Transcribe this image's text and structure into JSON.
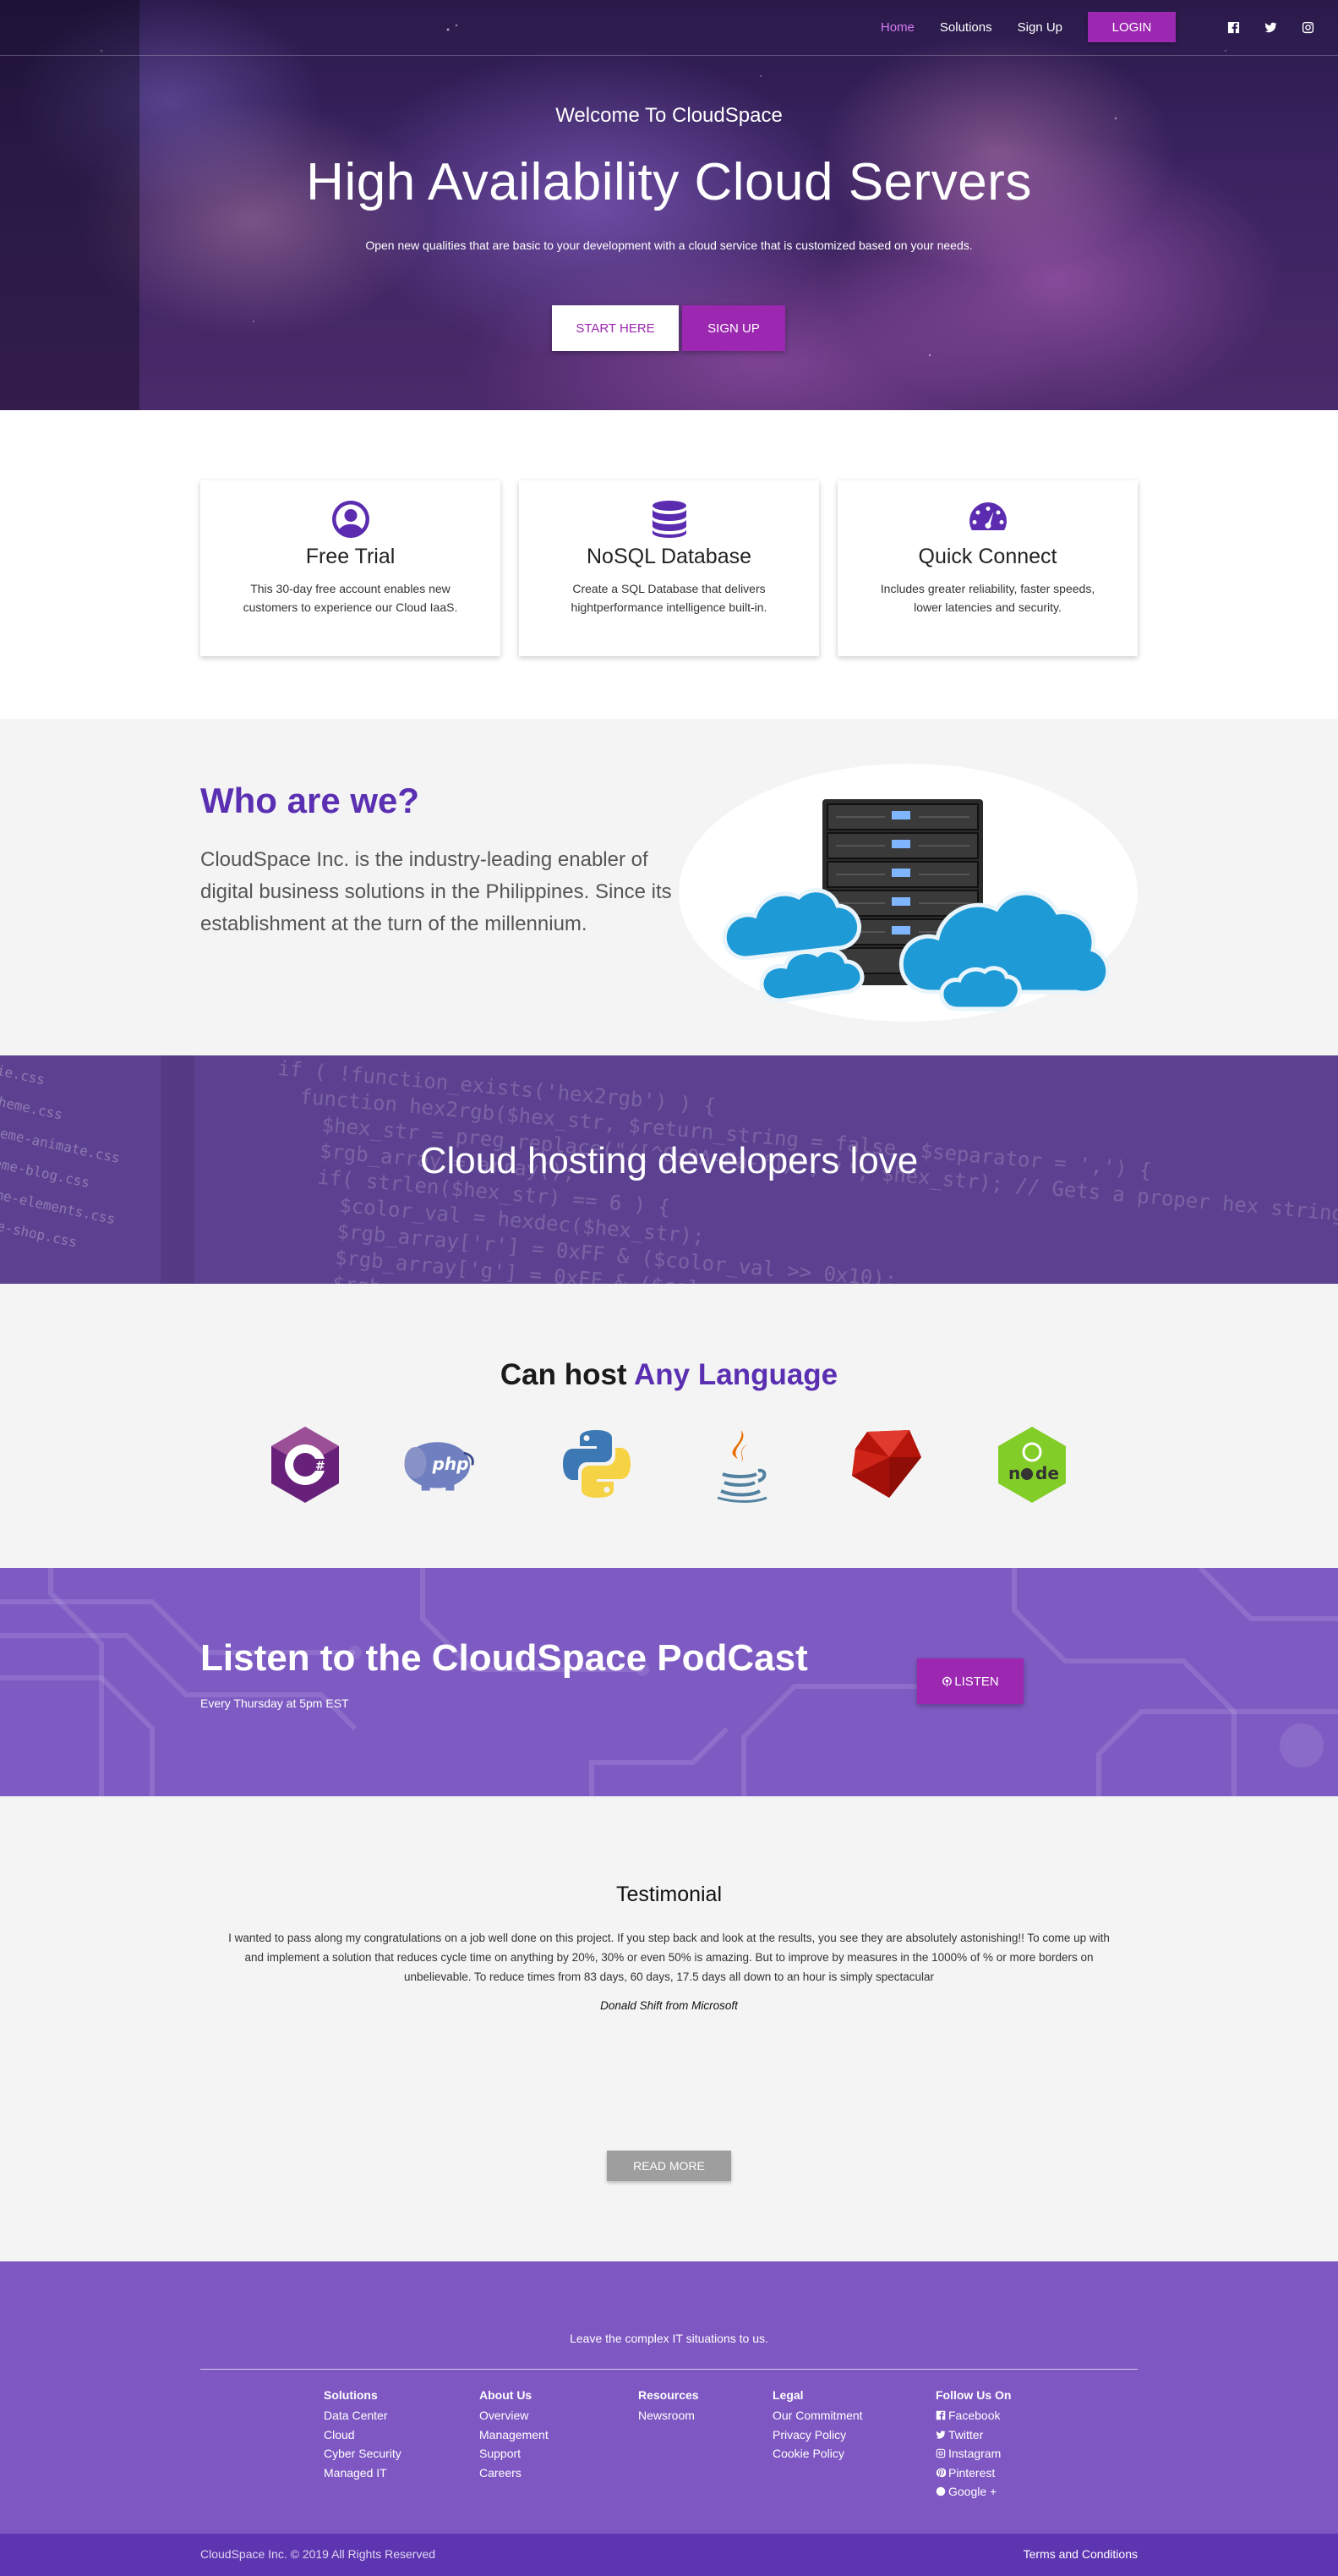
{
  "nav": {
    "links": [
      {
        "label": "Home",
        "active": true
      },
      {
        "label": "Solutions",
        "active": false
      },
      {
        "label": "Sign Up",
        "active": false
      }
    ],
    "login_label": "LOGIN",
    "social_icons": [
      "facebook-icon",
      "twitter-icon",
      "instagram-icon"
    ]
  },
  "hero": {
    "welcome": "Welcome To CloudSpace",
    "title": "High Availability Cloud Servers",
    "subtitle": "Open new qualities that are basic to your development with a cloud service that is customized based on your needs.",
    "start_label": "START HERE",
    "signup_label": "SIGN UP"
  },
  "features": [
    {
      "icon": "user-circle-icon",
      "title": "Free Trial",
      "desc": "This 30-day free account enables new customers to experience our Cloud IaaS."
    },
    {
      "icon": "database-icon",
      "title": "NoSQL Database",
      "desc": "Create a SQL Database that delivers hightperformance intelligence built-in."
    },
    {
      "icon": "speedometer-icon",
      "title": "Quick Connect",
      "desc": "Includes greater reliability, faster speeds, lower latencies and security."
    }
  ],
  "about": {
    "title": "Who are we?",
    "text": "CloudSpace Inc. is the industry-leading enabler of digital business solutions in the Philippines. Since its establishment at the turn of the millennium."
  },
  "dev_banner": {
    "title": "Cloud hosting developers love"
  },
  "languages": {
    "title_prefix": "Can host ",
    "title_accent": "Any Language",
    "logos": [
      "csharp-logo",
      "php-logo",
      "python-logo",
      "java-logo",
      "ruby-logo",
      "nodejs-logo"
    ]
  },
  "podcast": {
    "title": "Listen to the CloudSpace PodCast",
    "schedule": "Every Thursday at 5pm EST",
    "listen_label": "LISTEN"
  },
  "testimonial": {
    "heading": "Testimonial",
    "quote": "I wanted to pass along my congratulations on a job well done on this project. If you step back and look at the results, you see they are absolutely astonishing!! To come up with and implement a solution that reduces cycle time on anything by 20%, 30% or even 50% is amazing. But to improve by measures in the 1000% of % or more borders on unbelievable. To reduce times from 83 days, 60 days, 17.5 days all down to an hour is simply spectacular",
    "author": "Donald Shift from Microsoft",
    "read_more_label": "READ MORE"
  },
  "footer": {
    "tagline": "Leave the complex IT situations to us.",
    "columns": [
      {
        "heading": "Solutions",
        "items": [
          "Data Center",
          "Cloud",
          "Cyber Security",
          "Managed IT"
        ]
      },
      {
        "heading": "About Us",
        "items": [
          "Overview",
          "Management",
          "Support",
          "Careers"
        ]
      },
      {
        "heading": "Resources",
        "items": [
          "Newsroom"
        ]
      },
      {
        "heading": "Legal",
        "items": [
          "Our Commitment",
          "Privacy Policy",
          "Cookie Policy"
        ]
      },
      {
        "heading": "Follow Us On",
        "items": [
          "Facebook",
          "Twitter",
          "Instagram",
          "Pinterest",
          "Google +"
        ]
      }
    ],
    "copyright": "CloudSpace Inc. © 2019 All Rights Reserved",
    "terms_label": "Terms and Conditions"
  },
  "colors": {
    "accent_purple": "#9c27b0",
    "brand_purple": "#5a2fb2",
    "footer_purple": "#7e57c2",
    "bottom_bar": "#5e35b1",
    "active_nav": "#d77cf5"
  }
}
